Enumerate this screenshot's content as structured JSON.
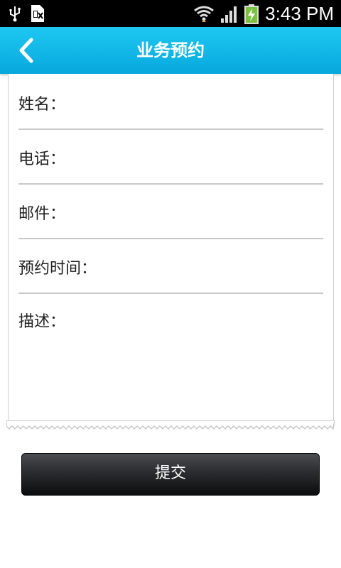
{
  "status_bar": {
    "time": "3:43 PM",
    "icons": [
      "usb-icon",
      "sim-card-icon",
      "wifi-icon",
      "signal-icon",
      "battery-charging-icon"
    ]
  },
  "header": {
    "title": "业务预约",
    "back_icon": "back-chevron-icon",
    "background": "#0db5e6"
  },
  "form": {
    "fields": [
      {
        "label": "姓名：",
        "value": ""
      },
      {
        "label": "电话：",
        "value": ""
      },
      {
        "label": "邮件：",
        "value": ""
      },
      {
        "label": "预约时间：",
        "value": ""
      }
    ],
    "description": {
      "label": "描述：",
      "value": ""
    }
  },
  "submit": {
    "label": "提交"
  }
}
